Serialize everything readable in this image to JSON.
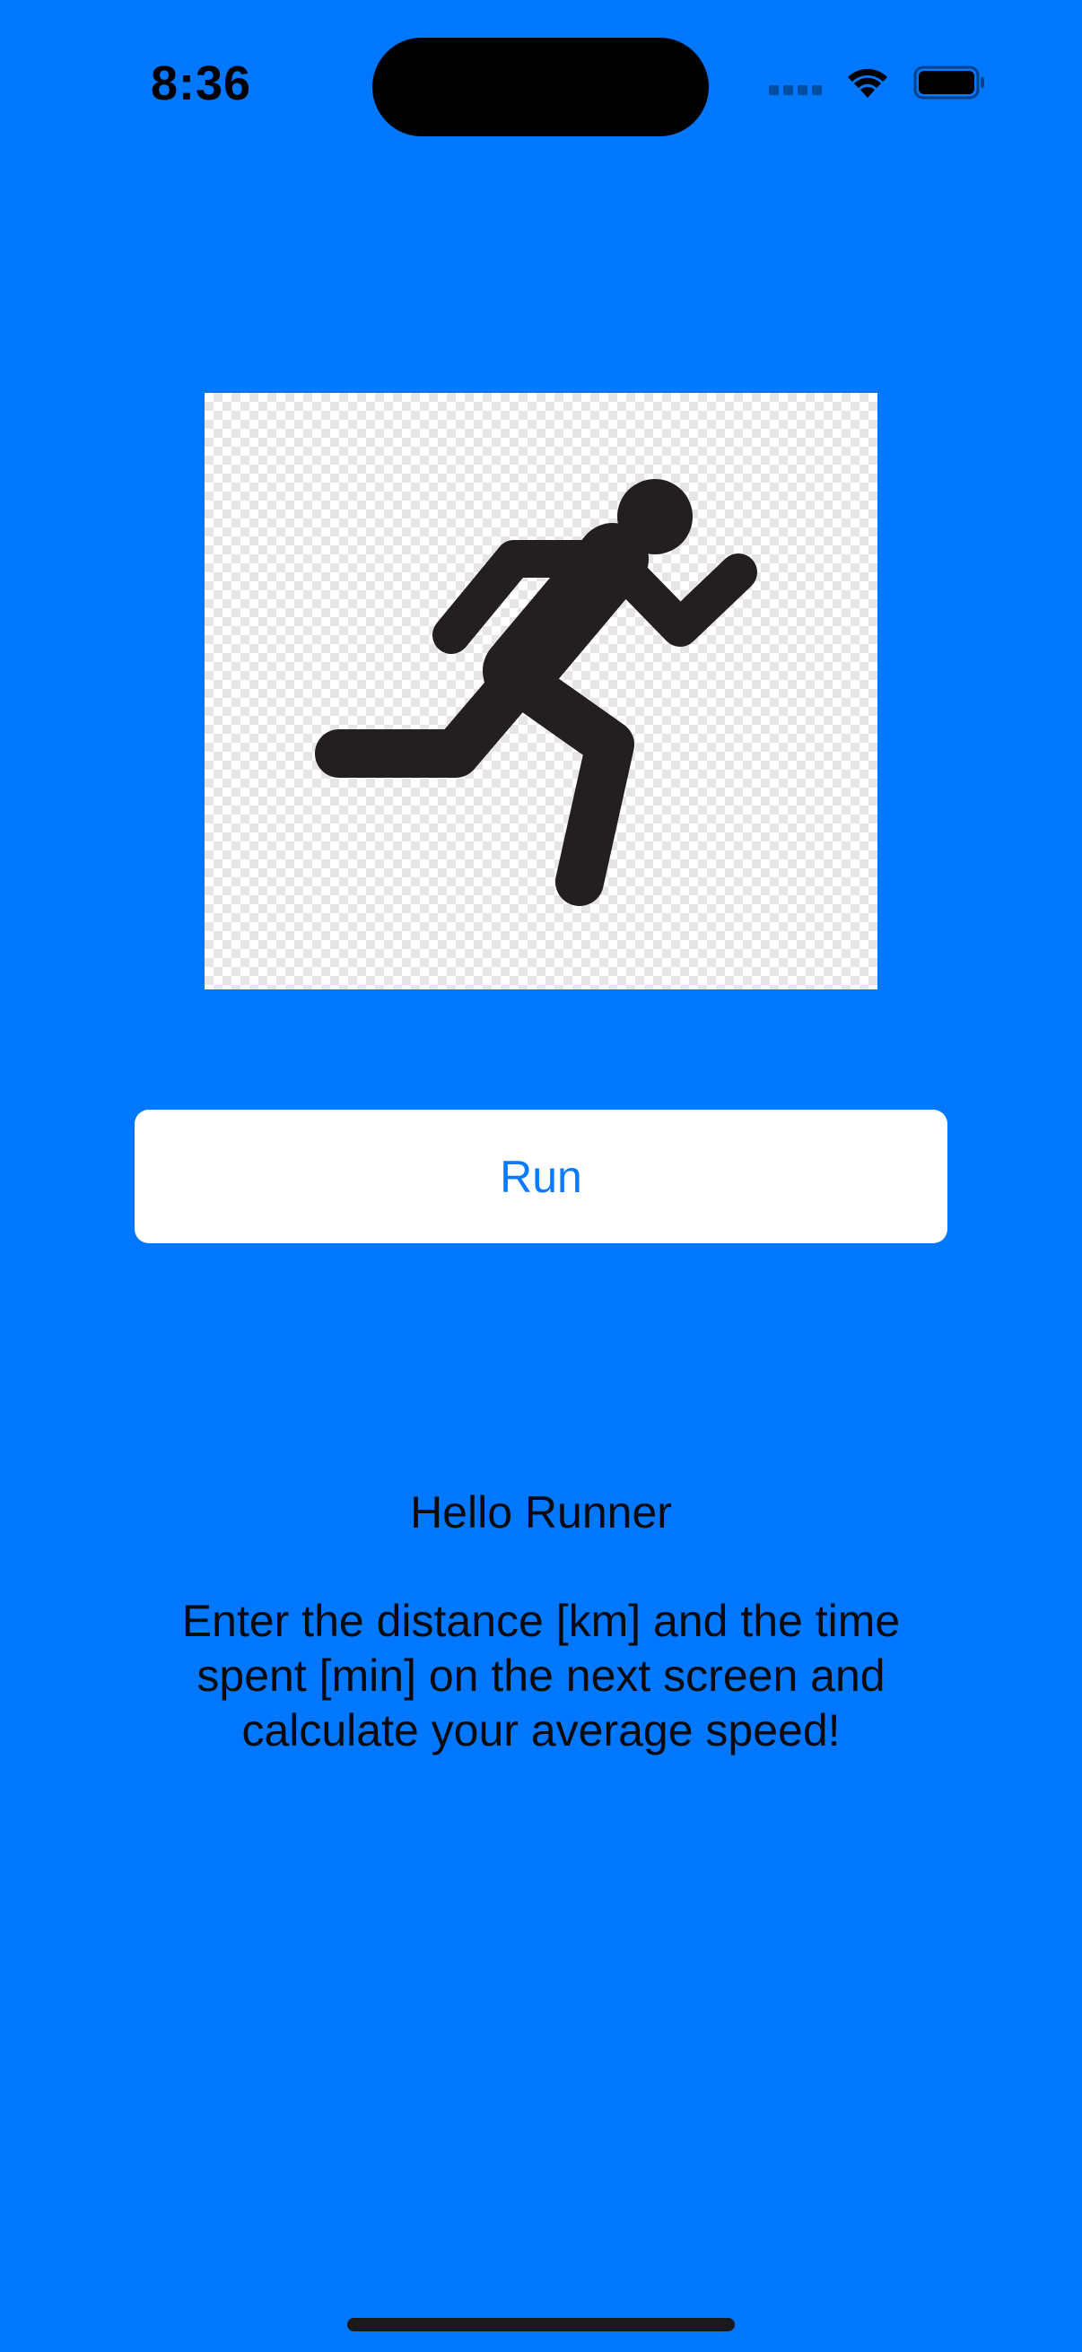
{
  "status_bar": {
    "time": "8:36",
    "icons": [
      "cellular-signal-icon",
      "wifi-icon",
      "battery-icon"
    ]
  },
  "hero": {
    "icon": "running-person-icon"
  },
  "run_button": {
    "label": "Run"
  },
  "content": {
    "greeting": "Hello Runner",
    "instructions": "Enter the distance [km] and the time spent [min] on the next screen and calculate your average speed!"
  },
  "colors": {
    "background": "#0077FF",
    "button_background": "#FFFFFF",
    "button_text": "#0A7AFF",
    "text": "#0A0A0A"
  }
}
